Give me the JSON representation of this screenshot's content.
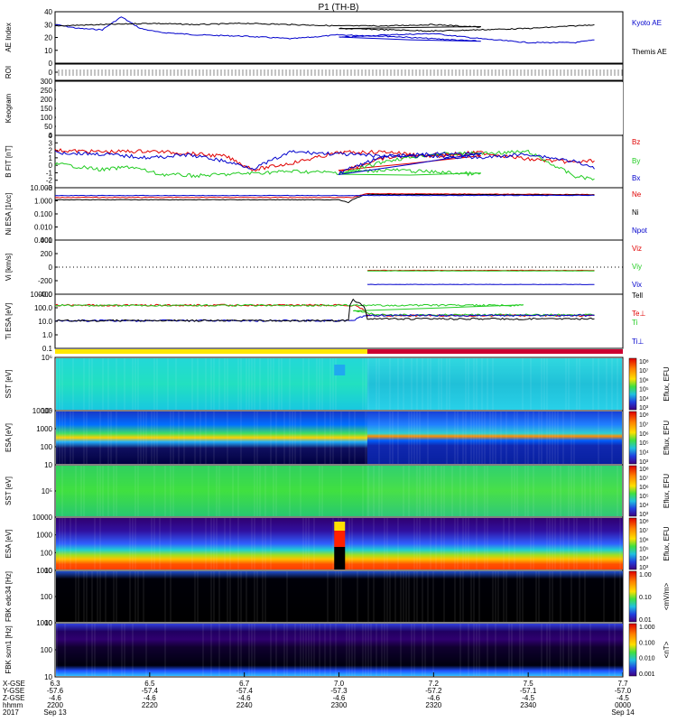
{
  "title": "P1 (TH-B)",
  "colors": {
    "red": "#e00000",
    "green": "#22cc22",
    "blue": "#0000cc",
    "black": "#000000",
    "yellow": "#ffe800",
    "crimson": "#cc0030"
  },
  "chart_data": [
    {
      "type": "line",
      "id": "ae",
      "ylabel": "AE Index",
      "yticks": [
        "40",
        "30",
        "20",
        "10",
        "0"
      ],
      "ylim": [
        0,
        40
      ],
      "series": [
        {
          "name": "Kyoto AE",
          "color": "#0000cc",
          "x": [
            2200,
            2205,
            2210,
            2214,
            2218,
            2222,
            2230,
            2240,
            2250,
            2260,
            2270,
            2280,
            2290,
            2300,
            2310,
            2320,
            2330,
            2340,
            2350,
            2354
          ],
          "values": [
            30,
            27,
            26,
            36,
            27,
            24,
            22,
            21,
            19,
            22,
            21,
            19,
            17,
            20,
            22,
            23,
            19,
            16,
            16,
            18
          ]
        },
        {
          "name": "Themis AE",
          "color": "#000000",
          "x": [
            2200,
            2210,
            2220,
            2230,
            2240,
            2250,
            2260,
            2270,
            2280,
            2290,
            2300,
            2310,
            2320,
            2330,
            2340,
            2350,
            2354
          ],
          "values": [
            29,
            30,
            31,
            30,
            31,
            30,
            29,
            29,
            30,
            28,
            27,
            26,
            25,
            26,
            27,
            29,
            30
          ]
        }
      ]
    },
    {
      "type": "table",
      "id": "roi",
      "ylabel": "ROI",
      "yticks": [
        "0"
      ]
    },
    {
      "type": "heatmap",
      "id": "keogram",
      "ylabel": "Keogram",
      "yticks": [
        "300",
        "250",
        "200",
        "150",
        "100",
        "50",
        "0"
      ],
      "ylim": [
        0,
        300
      ]
    },
    {
      "type": "line",
      "id": "bfit",
      "ylabel": "B FIT [nT]",
      "yticks": [
        "4",
        "3",
        "2",
        "1",
        "0",
        "-1",
        "-2",
        "-3"
      ],
      "ylim": [
        -3,
        4
      ],
      "series": [
        {
          "name": "Bz",
          "color": "#e00000",
          "x": [
            2200,
            2210,
            2220,
            2228,
            2236,
            2242,
            2250,
            2260,
            2270,
            2280,
            2290,
            2300,
            2310,
            2320,
            2330,
            2340,
            2350,
            2354
          ],
          "values": [
            2.0,
            1.8,
            1.9,
            1.6,
            1.2,
            -0.6,
            0.3,
            1.7,
            1.8,
            1.2,
            1.3,
            -0.8,
            1.0,
            1.4,
            1.7,
            0.8,
            0.4,
            0.6
          ]
        },
        {
          "name": "By",
          "color": "#22cc22",
          "x": [
            2200,
            2210,
            2216,
            2222,
            2230,
            2240,
            2250,
            2260,
            2270,
            2280,
            2290,
            2300,
            2310,
            2320,
            2330,
            2340,
            2350,
            2354
          ],
          "values": [
            0.2,
            -0.6,
            -0.2,
            -1.2,
            -1.4,
            -1.1,
            -0.8,
            -1.0,
            -0.6,
            -0.9,
            -1.2,
            -1.3,
            0.6,
            1.5,
            1.6,
            1.8,
            -1.5,
            -1.8
          ]
        },
        {
          "name": "Bx",
          "color": "#0000cc",
          "x": [
            2200,
            2210,
            2220,
            2228,
            2234,
            2242,
            2250,
            2260,
            2270,
            2280,
            2290,
            2300,
            2310,
            2320,
            2330,
            2340,
            2350,
            2354
          ],
          "values": [
            1.7,
            1.5,
            1.0,
            1.4,
            0.8,
            -0.4,
            1.8,
            1.5,
            1.2,
            1.5,
            1.4,
            -1.0,
            1.3,
            1.2,
            1.0,
            1.5,
            0.5,
            -0.5
          ]
        }
      ]
    },
    {
      "type": "line",
      "id": "ni",
      "ylabel": "Ni ESA [1/cc]",
      "yticks": [
        "10.000",
        "1.000",
        "0.100",
        "0.010",
        "0.001"
      ],
      "ylim": [
        0.001,
        10
      ],
      "log": true,
      "series": [
        {
          "name": "Ne",
          "color": "#e00000",
          "x": [
            2200,
            2303,
            2306,
            2354
          ],
          "values": [
            1.8,
            1.8,
            3.5,
            3.0
          ]
        },
        {
          "name": "Ni",
          "color": "#000000",
          "x": [
            2200,
            2300,
            2302,
            2306,
            2354
          ],
          "values": [
            1.2,
            1.2,
            0.7,
            3.0,
            2.8
          ]
        },
        {
          "name": "Npot",
          "color": "#0000cc",
          "x": [
            2200,
            2354
          ],
          "values": [
            2.5,
            2.6
          ]
        }
      ]
    },
    {
      "type": "line",
      "id": "vi",
      "ylabel": "Vi [km/s]",
      "yticks": [
        "400",
        "200",
        "0",
        "-200",
        "-400"
      ],
      "ylim": [
        -500,
        500
      ],
      "series": [
        {
          "name": "Viz",
          "color": "#e00000",
          "x": [
            2306,
            2354
          ],
          "values": [
            -60,
            -60
          ]
        },
        {
          "name": "Viy",
          "color": "#22cc22",
          "x": [
            2306,
            2354
          ],
          "values": [
            -70,
            -70
          ]
        },
        {
          "name": "Vix",
          "color": "#0000cc",
          "x": [
            2306,
            2354
          ],
          "values": [
            -320,
            -320
          ]
        },
        {
          "name": "Tell",
          "color": "#000000",
          "x": [],
          "values": []
        }
      ]
    },
    {
      "type": "line",
      "id": "ti",
      "ylabel": "Ti ESA [eV]",
      "yticks": [
        "1000.0",
        "100.0",
        "10.0",
        "1.0",
        "0.1"
      ],
      "ylim": [
        0.05,
        3000
      ],
      "log": true,
      "series": [
        {
          "name": "Te⊥",
          "color": "#e00000",
          "x": [
            2200,
            2303,
            2306,
            2354
          ],
          "values": [
            320,
            320,
            40,
            40
          ]
        },
        {
          "name": "Ti",
          "color": "#22cc22",
          "x": [
            2200,
            2299,
            2303,
            2308,
            2354
          ],
          "values": [
            310,
            310,
            100,
            45,
            45
          ]
        },
        {
          "name": "Ti⊥",
          "color": "#0000cc",
          "x": [
            2200,
            2303,
            2306,
            2354
          ],
          "values": [
            14,
            14,
            40,
            40
          ]
        },
        {
          "name": "TeII",
          "color": "#000000",
          "x": [
            2200,
            2302,
            2303,
            2306,
            2354
          ],
          "values": [
            14,
            14,
            900,
            20,
            20
          ]
        }
      ]
    },
    {
      "type": "heatmap",
      "id": "sst1",
      "ylabel": "SST [eV]",
      "yticks": [
        "10⁶",
        "10⁵"
      ],
      "zlabel": "Eflux, EFU",
      "ztickvals": [
        "10⁸",
        "10⁷",
        "10⁶",
        "10⁵",
        "10⁴",
        "10³"
      ]
    },
    {
      "type": "heatmap",
      "id": "esa1",
      "ylabel": "ESA [eV]",
      "yticks": [
        "10000",
        "1000",
        "100",
        "10"
      ],
      "zlabel": "Eflux, EFU",
      "ztickvals": [
        "10⁸",
        "10⁷",
        "10⁶",
        "10⁵",
        "10⁴",
        "10³"
      ]
    },
    {
      "type": "heatmap",
      "id": "sst2",
      "ylabel": "SST [eV]",
      "yticks": [
        "10⁵"
      ],
      "zlabel": "Eflux, EFU",
      "ztickvals": [
        "10⁸",
        "10⁷",
        "10⁶",
        "10⁵",
        "10⁴",
        "10³"
      ]
    },
    {
      "type": "heatmap",
      "id": "esa2",
      "ylabel": "ESA [eV]",
      "yticks": [
        "10000",
        "1000",
        "100",
        "10"
      ],
      "zlabel": "Eflux, EFU",
      "ztickvals": [
        "10⁸",
        "10⁷",
        "10⁶",
        "10⁵",
        "10⁴",
        "10³"
      ]
    },
    {
      "type": "heatmap",
      "id": "fbk1",
      "ylabel": "FBK edc34 [Hz]",
      "yticks": [
        "1000",
        "100",
        "10"
      ],
      "zlabel": "<mV/m>",
      "ztickvals": [
        "1.00",
        "0.10",
        "0.01"
      ]
    },
    {
      "type": "heatmap",
      "id": "fbk2",
      "ylabel": "FBK scm1 [Hz]",
      "yticks": [
        "1000",
        "100",
        "10"
      ],
      "zlabel": "<nT>",
      "ztickvals": [
        "1.000",
        "0.100",
        "0.010",
        "0.001"
      ]
    }
  ],
  "xaxis": {
    "row_labels": [
      "X-GSE",
      "Y-GSE",
      "Z-GSE",
      "hhmm",
      "2017"
    ],
    "ticks": [
      {
        "vals": [
          "6.3",
          "-57.6",
          "-4.6",
          "2200",
          "Sep 13"
        ]
      },
      {
        "vals": [
          "6.5",
          "-57.4",
          "-4.6",
          "2220",
          ""
        ]
      },
      {
        "vals": [
          "6.7",
          "-57.4",
          "-4.6",
          "2240",
          ""
        ]
      },
      {
        "vals": [
          "7.0",
          "-57.3",
          "-4.6",
          "2300",
          ""
        ]
      },
      {
        "vals": [
          "7.2",
          "-57.2",
          "-4.6",
          "2320",
          ""
        ]
      },
      {
        "vals": [
          "7.5",
          "-57.1",
          "-4.5",
          "2340",
          ""
        ]
      },
      {
        "vals": [
          "7.7",
          "-57.0",
          "-4.5",
          "0000",
          "Sep 14"
        ]
      }
    ]
  }
}
